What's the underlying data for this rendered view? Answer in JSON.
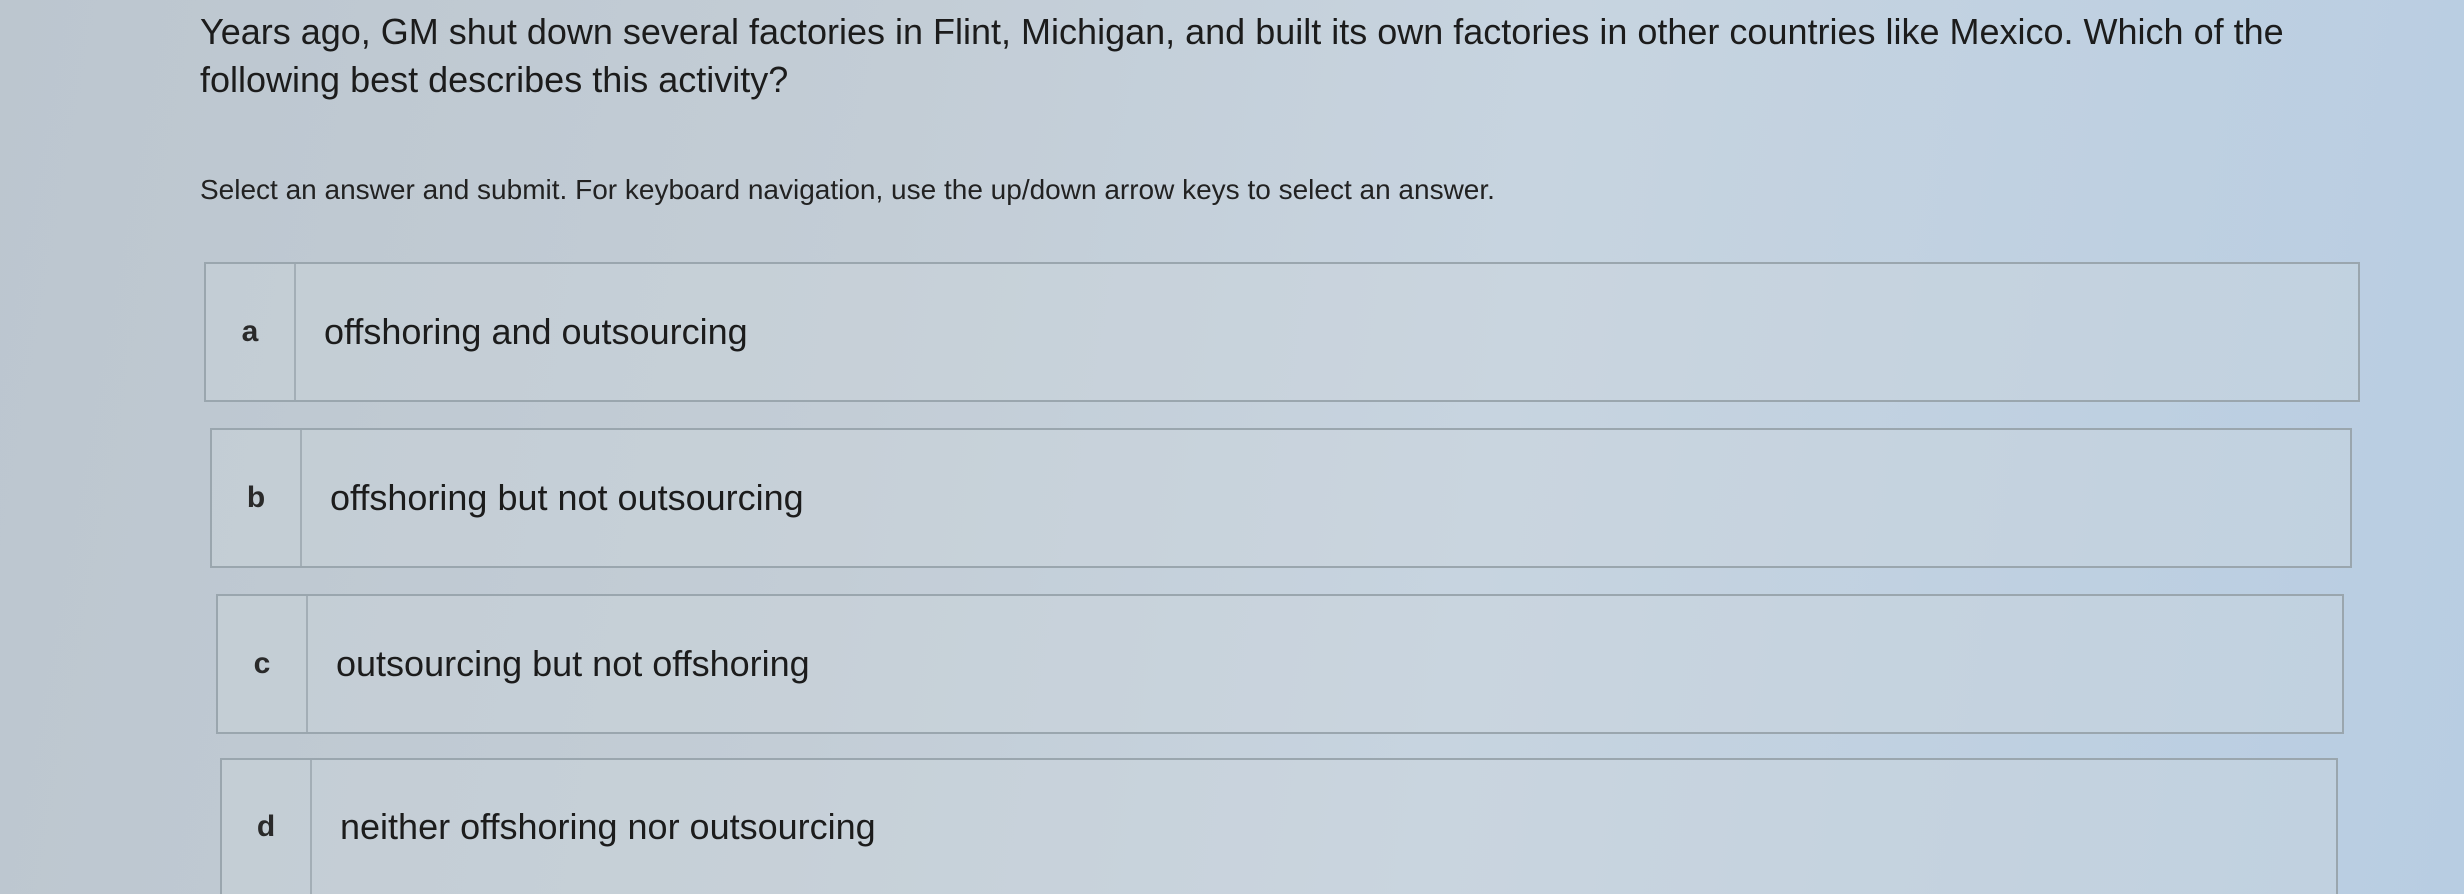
{
  "question": {
    "text": "Years ago, GM shut down several factories in Flint, Michigan, and built its own factories in other countries like Mexico. Which of the following best describes this activity?"
  },
  "instructions": "Select an answer and submit. For keyboard navigation, use the up/down arrow keys to select an answer.",
  "options": [
    {
      "letter": "a",
      "text": "offshoring and outsourcing"
    },
    {
      "letter": "b",
      "text": "offshoring but not outsourcing"
    },
    {
      "letter": "c",
      "text": "outsourcing but not offshoring"
    },
    {
      "letter": "d",
      "text": "neither offshoring nor outsourcing"
    }
  ]
}
